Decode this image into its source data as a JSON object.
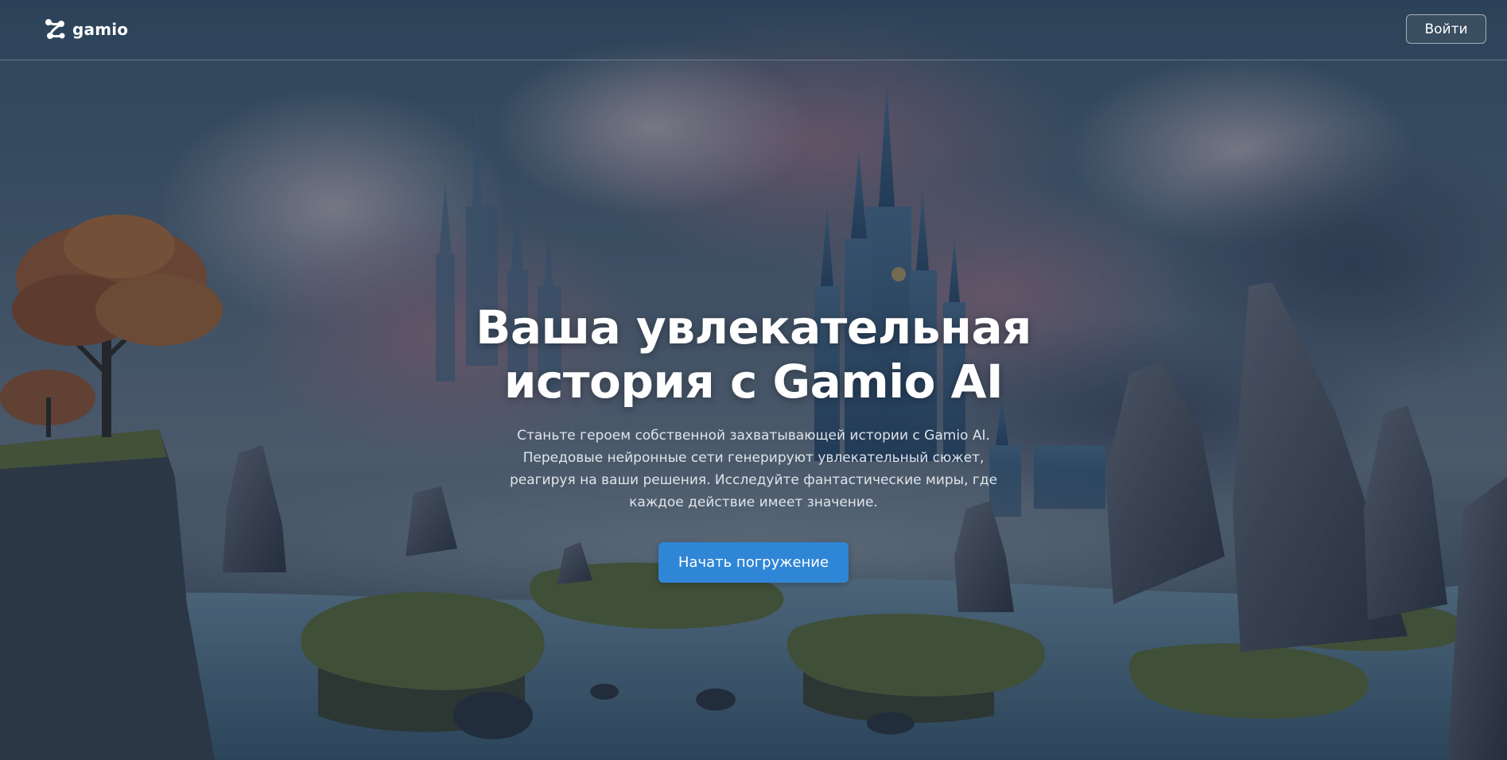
{
  "header": {
    "logo_text": "gamio",
    "login_label": "Войти"
  },
  "hero": {
    "title_line1": "Ваша увлекательная",
    "title_line2": "история с Gamio AI",
    "description": "Станьте героем собственной захватывающей истории с Gamio AI. Передовые нейронные сети генерируют увлекательный сюжет, реагируя на ваши решения. Исследуйте фантастические миры, где каждое действие имеет значение.",
    "cta_label": "Начать погружение"
  },
  "colors": {
    "accent": "#2f86d6",
    "overlay": "#142234",
    "text": "#ffffff"
  },
  "icons": {
    "logo": "gamio-logo-icon"
  }
}
